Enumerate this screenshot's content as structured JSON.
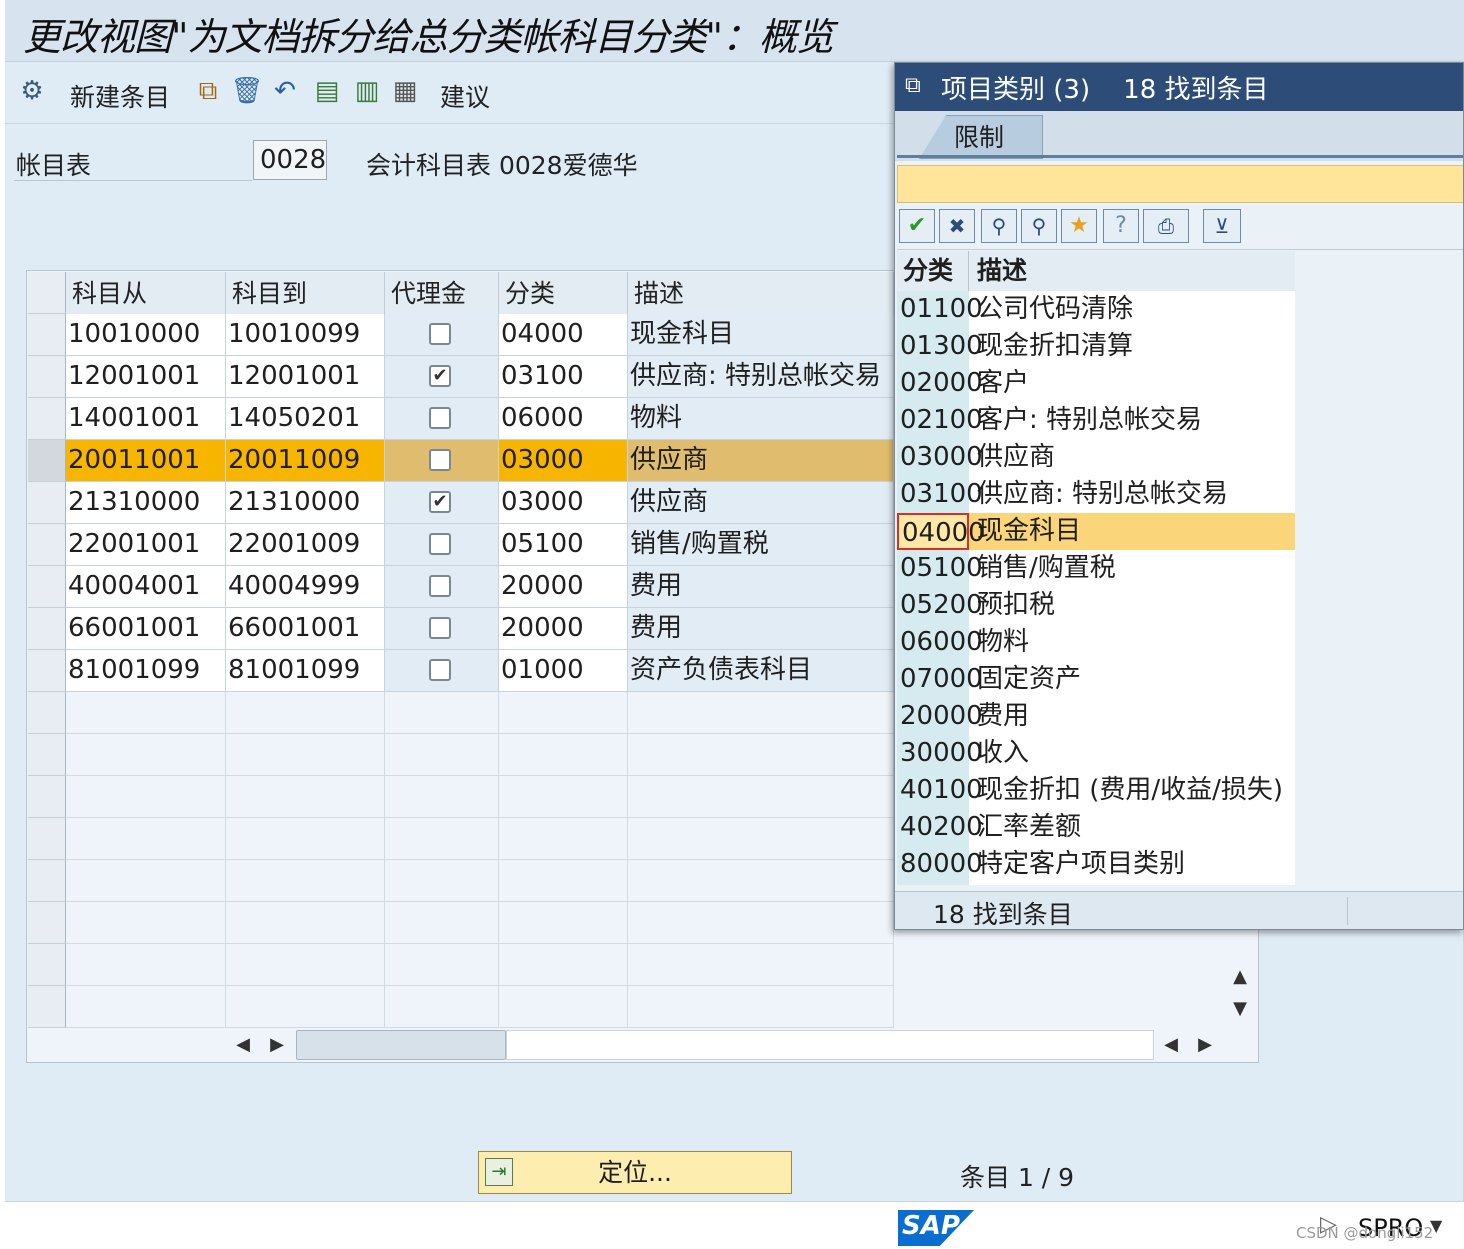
{
  "window": {
    "title": "更改视图\"为文档拆分给总分类帐科目分类\"：概览"
  },
  "toolbar": {
    "new_entries": "新建条目",
    "suggest": "建议"
  },
  "header": {
    "chart_label": "帐目表",
    "chart_value": "0028",
    "chart_desc": "会计科目表 0028爱德华"
  },
  "table": {
    "columns": [
      "科目从",
      "科目到",
      "代理金",
      "分类",
      "描述"
    ],
    "rows": [
      {
        "from": "10010000",
        "to": "10010099",
        "proxy": false,
        "cls": "04000",
        "desc": "现金科目",
        "highlight": false
      },
      {
        "from": "12001001",
        "to": "12001001",
        "proxy": true,
        "cls": "03100",
        "desc": "供应商: 特别总帐交易",
        "highlight": false
      },
      {
        "from": "14001001",
        "to": "14050201",
        "proxy": false,
        "cls": "06000",
        "desc": "物料",
        "highlight": false
      },
      {
        "from": "20011001",
        "to": "20011009",
        "proxy": false,
        "cls": "03000",
        "desc": "供应商",
        "highlight": true
      },
      {
        "from": "21310000",
        "to": "21310000",
        "proxy": true,
        "cls": "03000",
        "desc": "供应商",
        "highlight": false
      },
      {
        "from": "22001001",
        "to": "22001009",
        "proxy": false,
        "cls": "05100",
        "desc": "销售/购置税",
        "highlight": false
      },
      {
        "from": "40004001",
        "to": "40004999",
        "proxy": false,
        "cls": "20000",
        "desc": "费用",
        "highlight": false
      },
      {
        "from": "66001001",
        "to": "66001001",
        "proxy": false,
        "cls": "20000",
        "desc": "费用",
        "highlight": false
      },
      {
        "from": "81001099",
        "to": "81001099",
        "proxy": false,
        "cls": "01000",
        "desc": "资产负债表科目",
        "highlight": false
      }
    ]
  },
  "footer": {
    "locate": "定位...",
    "entry": "条目 1 / 9"
  },
  "popup": {
    "title": "项目类别 (3)    18 找到条目",
    "tab": "限制",
    "col_class": "分类",
    "col_desc": "描述",
    "rows": [
      {
        "code": "01100",
        "desc": "公司代码清除"
      },
      {
        "code": "01300",
        "desc": "现金折扣清算"
      },
      {
        "code": "02000",
        "desc": "客户"
      },
      {
        "code": "02100",
        "desc": "客户: 特别总帐交易"
      },
      {
        "code": "03000",
        "desc": "供应商"
      },
      {
        "code": "03100",
        "desc": "供应商: 特别总帐交易"
      },
      {
        "code": "04000",
        "desc": "现金科目"
      },
      {
        "code": "05100",
        "desc": "销售/购置税"
      },
      {
        "code": "05200",
        "desc": "预扣税"
      },
      {
        "code": "06000",
        "desc": "物料"
      },
      {
        "code": "07000",
        "desc": "固定资产"
      },
      {
        "code": "20000",
        "desc": "费用"
      },
      {
        "code": "30000",
        "desc": "收入"
      },
      {
        "code": "40100",
        "desc": "现金折扣 (费用/收益/损失)"
      },
      {
        "code": "40200",
        "desc": "汇率差额"
      },
      {
        "code": "80000",
        "desc": "特定客户项目类别"
      }
    ],
    "selected_index": 6,
    "status": "18 找到条目"
  },
  "status_bar": {
    "logo": "SAP",
    "tcode": "SPRO",
    "watermark": "CSDN @dongli152"
  },
  "colors": {
    "accent": "#f7b500",
    "highlight_row": "#e0bd6e",
    "popup_sel": "#fbd57a",
    "locate_btn": "#fdeeb0"
  }
}
